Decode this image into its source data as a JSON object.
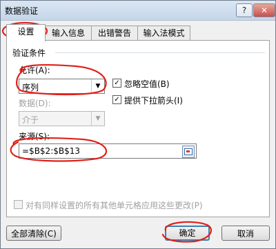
{
  "window": {
    "title": "数据验证",
    "help_label": "?",
    "close_label": "✕"
  },
  "tabs": [
    {
      "label": "设置",
      "active": true
    },
    {
      "label": "输入信息",
      "active": false
    },
    {
      "label": "出错警告",
      "active": false
    },
    {
      "label": "输入法模式",
      "active": false
    }
  ],
  "settings": {
    "section_title": "验证条件",
    "allow_label": "允许(A):",
    "allow_value": "序列",
    "ignore_blank_label": "忽略空值(B)",
    "ignore_blank_checked": true,
    "dropdown_label": "提供下拉箭头(I)",
    "dropdown_checked": true,
    "data_label": "数据(D):",
    "data_value": "介于",
    "source_label": "来源(S):",
    "source_value": "=$B$2:$B$13",
    "apply_all_label": "对有同样设置的所有其他单元格应用这些更改(P)",
    "apply_all_checked": false
  },
  "footer": {
    "clear_all_label": "全部清除(C)",
    "ok_label": "确定",
    "cancel_label": "取消"
  },
  "annotation_color": "#e0201a"
}
